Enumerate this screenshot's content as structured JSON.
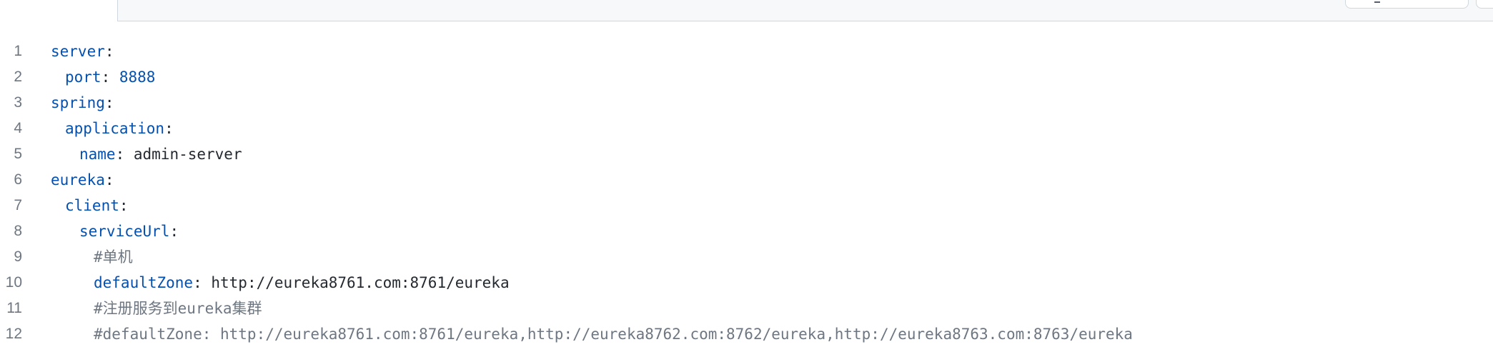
{
  "colors": {
    "key": "#0550ae",
    "number": "#0550ae",
    "text": "#24292f",
    "comment": "#6e7781",
    "line_number": "#6e7781"
  },
  "lines": [
    {
      "num": "1",
      "indent": 0,
      "key": "server",
      "sep": ":"
    },
    {
      "num": "2",
      "indent": 1,
      "key": "port",
      "sep": ": ",
      "value": "8888",
      "value_type": "number"
    },
    {
      "num": "3",
      "indent": 0,
      "key": "spring",
      "sep": ":"
    },
    {
      "num": "4",
      "indent": 1,
      "key": "application",
      "sep": ":"
    },
    {
      "num": "5",
      "indent": 2,
      "key": "name",
      "sep": ": ",
      "value": "admin-server",
      "value_type": "string"
    },
    {
      "num": "6",
      "indent": 0,
      "key": "eureka",
      "sep": ":"
    },
    {
      "num": "7",
      "indent": 1,
      "key": "client",
      "sep": ":"
    },
    {
      "num": "8",
      "indent": 2,
      "key": "serviceUrl",
      "sep": ":"
    },
    {
      "num": "9",
      "indent": 3,
      "comment": "#单机"
    },
    {
      "num": "10",
      "indent": 3,
      "key": "defaultZone",
      "sep": ": ",
      "value": "http://eureka8761.com:8761/eureka",
      "value_type": "string"
    },
    {
      "num": "11",
      "indent": 3,
      "comment": "#注册服务到eureka集群"
    },
    {
      "num": "12",
      "indent": 3,
      "comment": "#defaultZone: http://eureka8761.com:8761/eureka,http://eureka8762.com:8762/eureka,http://eureka8763.com:8763/eureka"
    }
  ]
}
